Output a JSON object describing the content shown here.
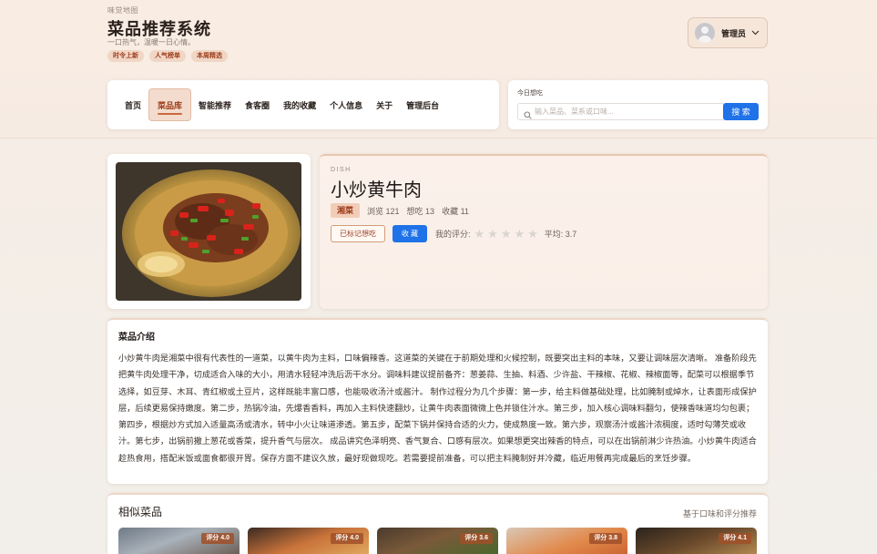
{
  "header": {
    "brand_sub": "味觉地图",
    "title": "菜品推荐系统",
    "slogan": "一口热气，温暖一日心情。",
    "tags": [
      "时令上新",
      "人气榜单",
      "本周精选"
    ],
    "user": {
      "name": "管理员"
    }
  },
  "nav": {
    "items": [
      "首页",
      "菜品库",
      "智能推荐",
      "食客圈",
      "我的收藏",
      "个人信息",
      "关于",
      "管理后台"
    ],
    "active": "菜品库"
  },
  "search": {
    "label": "今日想吃",
    "placeholder": "输入菜品、菜系或口味...",
    "button": "搜 索"
  },
  "dish": {
    "label": "DISH",
    "name": "小炒黄牛肉",
    "cuisine": "湘菜",
    "views": "浏览 121",
    "want": "想吃 13",
    "favorites": "收藏 11",
    "marked_button": "已标记想吃",
    "favorite_button": "收 藏",
    "my_rating_label": "我的评分:",
    "my_rating": 0,
    "max_rating": 5,
    "average": "平均: 3.7"
  },
  "intro": {
    "title": "菜品介绍",
    "text": "小炒黄牛肉是湘菜中很有代表性的一道菜，以黄牛肉为主料，口味偏辣香。这道菜的关键在于前期处理和火候控制，既要突出主料的本味，又要让调味层次清晰。 准备阶段先把黄牛肉处理干净，切成适合入味的大小，用清水轻轻冲洗后沥干水分。调味料建议提前备齐：葱姜蒜、生抽、料酒、少许盐、干辣椒、花椒、辣椒面等，配菜可以根据季节选择，如豆芽、木耳、青红椒或土豆片，这样既能丰富口感，也能吸收汤汁或酱汁。 制作过程分为几个步骤：第一步，给主料做基础处理，比如腌制或焯水，让表面形成保护层，后续更易保持嫩度。第二步，热锅冷油，先爆香香料，再加入主料快速翻炒，让黄牛肉表面微微上色并锁住汁水。第三步，加入核心调味料翻匀，使辣香味道均匀包裹；第四步，根据炒方式加入适量高汤或清水，转中小火让味道渗透。第五步，配菜下锅并保持合适的火力，使成熟度一致。第六步，观察汤汁或酱汁浓稠度，适时勾薄芡或收汁。第七步，出锅前撒上葱花或香菜，提升香气与层次。 成品讲究色泽明亮、香气复合、口感有层次。如果想更突出辣香的特点，可以在出锅前淋少许热油。小炒黄牛肉适合趁热食用，搭配米饭或面食都很开胃。保存方面不建议久放，最好现做现吃。若需要提前准备，可以把主料腌制好并冷藏，临近用餐再完成最后的烹饪步骤。"
  },
  "similar": {
    "title": "相似菜品",
    "hint": "基于口味和评分推荐",
    "items": [
      {
        "score": "评分 4.0"
      },
      {
        "score": "评分 4.0"
      },
      {
        "score": "评分 3.6"
      },
      {
        "score": "评分 3.8"
      },
      {
        "score": "评分 4.1"
      }
    ]
  },
  "colors": {
    "accent": "#1f72e8",
    "brand": "#9c3b18",
    "tag_bg": "#f1d6c6"
  }
}
